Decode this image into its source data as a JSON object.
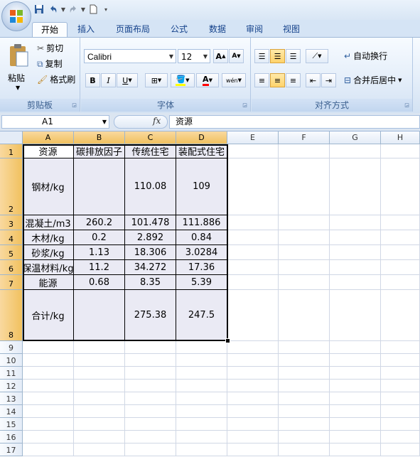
{
  "qat": {
    "save_icon": "save-icon",
    "undo_icon": "undo-icon",
    "redo_icon": "redo-icon",
    "new_icon": "new-document-icon"
  },
  "tabs": [
    {
      "label": "开始",
      "active": true
    },
    {
      "label": "插入"
    },
    {
      "label": "页面布局"
    },
    {
      "label": "公式"
    },
    {
      "label": "数据"
    },
    {
      "label": "审阅"
    },
    {
      "label": "视图"
    }
  ],
  "clipboard": {
    "paste": "粘贴",
    "cut": "剪切",
    "copy": "复制",
    "format_painter": "格式刷",
    "label": "剪贴板"
  },
  "font": {
    "name": "Calibri",
    "size": "12",
    "label": "字体",
    "bold": "B",
    "italic": "I",
    "underline": "U",
    "grow": "A",
    "shrink": "A",
    "phonetic": "wén"
  },
  "alignment": {
    "wrap_text": "自动换行",
    "merge_center": "合并后居中",
    "label": "对齐方式"
  },
  "formula_bar": {
    "name_box": "A1",
    "fx": "fx",
    "content": "资源"
  },
  "columns": [
    "A",
    "B",
    "C",
    "D",
    "E",
    "F",
    "G",
    "H"
  ],
  "rows": [
    "1",
    "2",
    "3",
    "4",
    "5",
    "6",
    "7",
    "8",
    "9",
    "10",
    "11",
    "12",
    "13",
    "14",
    "15",
    "16",
    "17"
  ],
  "table": [
    [
      "资源",
      "碳排放因子",
      "传统住宅",
      "装配式住宅"
    ],
    [
      "钢材/kg",
      "",
      "110.08",
      "109"
    ],
    [
      "混凝土/m3",
      "260.2",
      "101.478",
      "111.886"
    ],
    [
      "木材/kg",
      "0.2",
      "2.892",
      "0.84"
    ],
    [
      "砂浆/kg",
      "1.13",
      "18.306",
      "3.0284"
    ],
    [
      "保温材料/kg",
      "11.2",
      "34.272",
      "17.36"
    ],
    [
      "能源",
      "0.68",
      "8.35",
      "5.39"
    ],
    [
      "合计/kg",
      "",
      "275.38",
      "247.5"
    ]
  ],
  "colors": {
    "accent": "#15428b",
    "selection_header": "#f1c15f",
    "table_fill": "#eaeaf4"
  }
}
